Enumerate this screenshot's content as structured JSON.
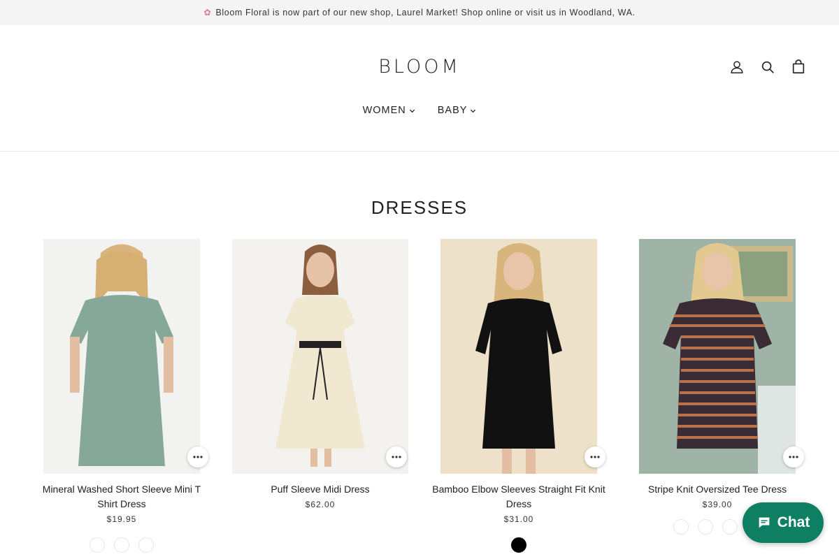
{
  "announcement": {
    "text": "Bloom Floral is now part of our new shop, Laurel Market! Shop online or visit us in Woodland, WA."
  },
  "header": {
    "logo": "BLOOM"
  },
  "nav": [
    {
      "label": "WOMEN"
    },
    {
      "label": "BABY"
    }
  ],
  "section": {
    "title": "DRESSES"
  },
  "products": [
    {
      "name": "Mineral Washed Short Sleeve Mini T Shirt Dress",
      "price": "$19.95",
      "swatches": [
        "#ffffff",
        "#ffffff",
        "#ffffff"
      ]
    },
    {
      "name": "Puff Sleeve Midi Dress",
      "price": "$62.00",
      "swatches": []
    },
    {
      "name": "Bamboo Elbow Sleeves Straight Fit Knit Dress",
      "price": "$31.00",
      "swatches": [
        "#000000"
      ]
    },
    {
      "name": "Stripe Knit Oversized Tee Dress",
      "price": "$39.00",
      "swatches": [
        "#ffffff",
        "#ffffff",
        "#ffffff",
        "#ffffff"
      ]
    }
  ],
  "chat": {
    "label": "Chat"
  },
  "colors": {
    "announce_bg": "#f4f4f4",
    "chat_green": "#0e7f63",
    "accent_text": "#222222"
  }
}
